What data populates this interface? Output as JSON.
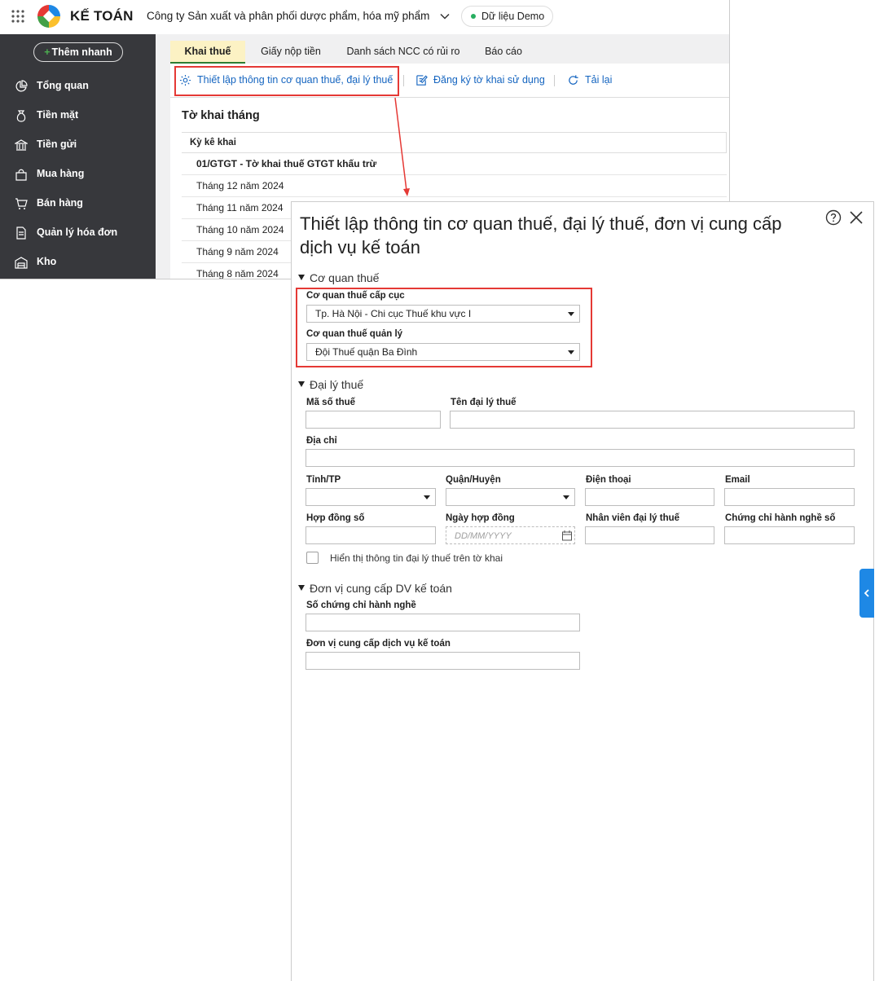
{
  "app": {
    "brand": "KẾ TOÁN",
    "company": "Công ty Sản xuất và phân phối dược phẩm, hóa mỹ phẩm",
    "demo_badge": "Dữ liệu Demo"
  },
  "sidebar": {
    "quick_add": "Thêm nhanh",
    "items": [
      {
        "label": "Tổng quan",
        "icon": "pie-chart-icon"
      },
      {
        "label": "Tiền mặt",
        "icon": "money-bag-icon"
      },
      {
        "label": "Tiền gửi",
        "icon": "bank-icon"
      },
      {
        "label": "Mua hàng",
        "icon": "shopping-bag-icon"
      },
      {
        "label": "Bán hàng",
        "icon": "cart-icon"
      },
      {
        "label": "Quản lý hóa đơn",
        "icon": "invoice-icon"
      },
      {
        "label": "Kho",
        "icon": "warehouse-icon"
      }
    ]
  },
  "tabs": [
    {
      "label": "Khai thuế",
      "active": true
    },
    {
      "label": "Giấy nộp tiền",
      "active": false
    },
    {
      "label": "Danh sách NCC có rủi ro",
      "active": false
    },
    {
      "label": "Báo cáo",
      "active": false
    }
  ],
  "toolbar": {
    "setup": "Thiết lập thông tin cơ quan thuế, đại lý thuế",
    "register": "Đăng ký tờ khai sử dụng",
    "reload": "Tải lại"
  },
  "panel": {
    "title": "Tờ khai tháng",
    "column": "Kỳ kê khai",
    "group": "01/GTGT - Tờ khai thuế GTGT khấu trừ",
    "rows": [
      "Tháng 12 năm 2024",
      "Tháng 11 năm 2024",
      "Tháng 10 năm 2024",
      "Tháng 9 năm 2024",
      "Tháng 8 năm 2024"
    ]
  },
  "dialog": {
    "title": "Thiết lập thông tin cơ quan thuế, đại lý thuế, đơn vị cung cấp dịch vụ kế toán",
    "tax_office": {
      "section": "Cơ quan thuế",
      "dept_label": "Cơ quan thuế cấp cục",
      "dept_value": "Tp. Hà Nội - Chi cục Thuế khu vực I",
      "mgmt_label": "Cơ quan thuế quản lý",
      "mgmt_value": "Đội Thuế quận Ba Đình"
    },
    "agent": {
      "section": "Đại lý thuế",
      "tax_code": "Mã số thuế",
      "name": "Tên đại lý thuế",
      "address": "Địa chỉ",
      "province": "Tỉnh/TP",
      "district": "Quận/Huyện",
      "phone": "Điện thoại",
      "email": "Email",
      "contract_no": "Hợp đồng số",
      "contract_date": "Ngày hợp đồng",
      "date_placeholder": "DD/MM/YYYY",
      "staff": "Nhân viên đại lý thuế",
      "cert": "Chứng chỉ hành nghề số",
      "show_on_form": "Hiển thị thông tin đại lý thuế trên tờ khai"
    },
    "provider": {
      "section": "Đơn vị cung cấp DV kế toán",
      "cert_no": "Số chứng chỉ hành nghề",
      "provider_name": "Đơn vị cung cấp dịch vụ kế toán"
    }
  },
  "colors": {
    "accent": "#1565c0",
    "highlight": "#e53935",
    "sidebar": "#37383c",
    "active_tab": "#fcf2c4"
  }
}
